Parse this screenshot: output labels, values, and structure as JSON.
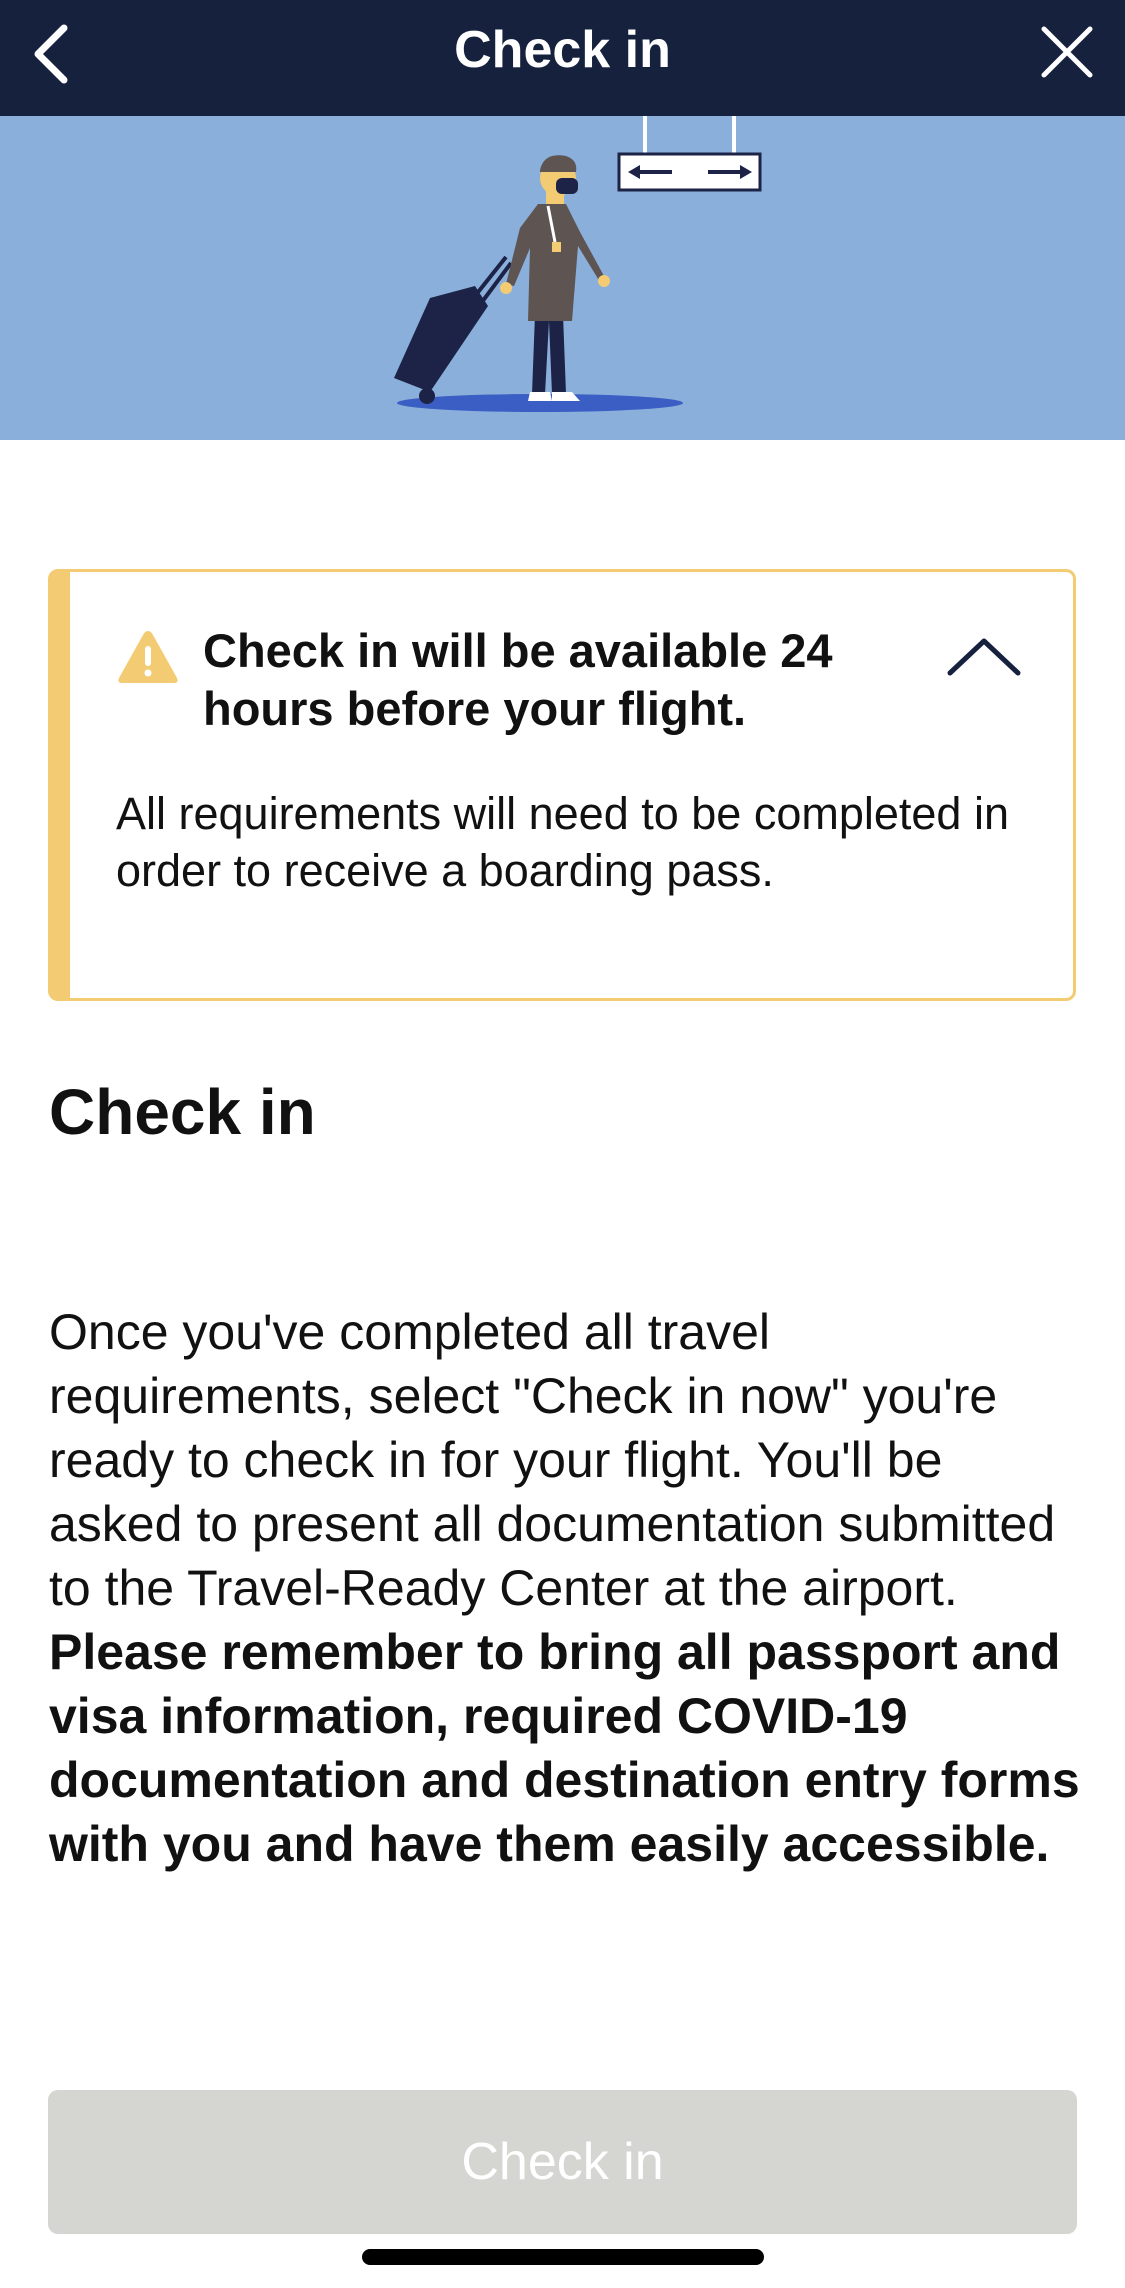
{
  "navbar": {
    "title": "Check in",
    "back_icon": "chevron-left-icon",
    "close_icon": "close-icon",
    "background_color": "#16213e"
  },
  "hero": {
    "background_color": "#8aafdb",
    "illustration": "traveler-with-suitcase",
    "sign_icon": "direction-arrows-sign"
  },
  "alert": {
    "icon": "warning-icon",
    "title": "Check in will be available 24 hours before your flight.",
    "body": "All requirements will need to be completed in order to receive a boarding pass.",
    "toggle_icon": "chevron-up-icon",
    "accent_color": "#f3cb73"
  },
  "section": {
    "title": "Check in",
    "description_regular": "Once you've completed all travel requirements, select \"Check in now\" you're ready to check in for your flight. You'll be asked to present all documentation submitted to the Travel-Ready Center at the airport. ",
    "description_bold": "Please remember to bring all passport and visa information, required COVID-19 documentation and destination entry forms with you and have them easily accessible."
  },
  "button": {
    "label": "Check in",
    "state": "disabled",
    "background_color": "#d5d5d2"
  }
}
